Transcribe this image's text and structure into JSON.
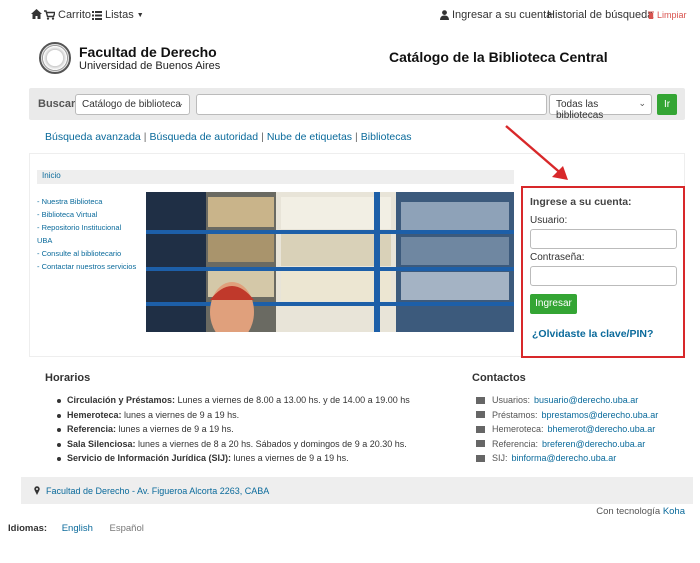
{
  "topnav": {
    "cart": "Carrito",
    "lists": "Listas",
    "login": "Ingresar a su cuenta",
    "history": "Historial de búsqueda",
    "clear": "Limpiar"
  },
  "header": {
    "faculty": "Facultad de Derecho",
    "university": "Universidad de Buenos Aires",
    "catalog_title": "Catálogo de la Biblioteca Central"
  },
  "search": {
    "label": "Buscar",
    "type_select": "Catálogo de biblioteca",
    "library_select": "Todas las bibliotecas",
    "go": "Ir"
  },
  "links": [
    "Búsqueda avanzada",
    "Búsqueda de autoridad",
    "Nube de etiquetas",
    "Bibliotecas"
  ],
  "breadcrumb": "Inicio",
  "side_links": [
    "- Nuestra Biblioteca",
    "- Biblioteca Virtual",
    "- Repositorio Institucional UBA",
    "- Consulte al bibliotecario",
    "- Contactar nuestros servicios"
  ],
  "login": {
    "title": "Ingrese a su cuenta:",
    "user_label": "Usuario:",
    "pass_label": "Contraseña:",
    "button": "Ingresar",
    "forgot": "¿Olvidaste la clave/PIN?"
  },
  "horarios": {
    "title": "Horarios",
    "items": [
      {
        "name": "Circulación y Préstamos:",
        "text": " Lunes a viernes de 8.00 a 13.00 hs. y de 14.00 a 19.00 hs"
      },
      {
        "name": "Hemeroteca:",
        "text": " lunes a viernes de 9 a 19 hs."
      },
      {
        "name": "Referencia:",
        "text": " lunes a viernes de 9 a 19 hs."
      },
      {
        "name": "Sala Silenciosa:",
        "text": " lunes a viernes de 8 a 20 hs. Sábados y domingos de 9 a 20.30 hs."
      },
      {
        "name": "Servicio de Información Jurídica (SIJ):",
        "text": " lunes a viernes de 9 a 19 hs."
      }
    ]
  },
  "contactos": {
    "title": "Contactos",
    "items": [
      {
        "label": "Usuarios: ",
        "email": "busuario@derecho.uba.ar"
      },
      {
        "label": "Préstamos: ",
        "email": "bprestamos@derecho.uba.ar"
      },
      {
        "label": "Hemeroteca: ",
        "email": "bhemerot@derecho.uba.ar"
      },
      {
        "label": "Referencia: ",
        "email": "breferen@derecho.uba.ar"
      },
      {
        "label": "SIJ: ",
        "email": "binforma@derecho.uba.ar"
      }
    ]
  },
  "footer": {
    "address": "Facultad de Derecho - Av. Figueroa Alcorta 2263, CABA",
    "powered_prefix": "Con tecnología ",
    "powered_brand": "Koha"
  },
  "languages": {
    "label": "Idiomas:",
    "current": "English",
    "other": "Español"
  }
}
